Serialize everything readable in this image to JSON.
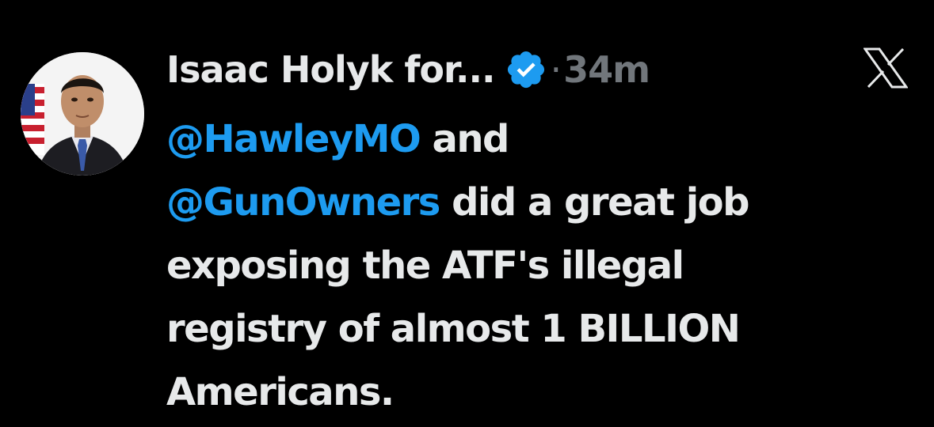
{
  "colors": {
    "background": "#000000",
    "text": "#e7e9ea",
    "mention": "#1d9bf0",
    "secondary": "#71767b",
    "verified": "#1d9bf0"
  },
  "author": {
    "display_name": "Isaac Holyk for...",
    "verified_icon": "verified-badge-icon",
    "separator": "·",
    "time": "34m",
    "avatar_icon": "profile-photo"
  },
  "brand_icon": "x-logo-icon",
  "tweet": {
    "line1": {
      "mention": "@HawleyMO",
      "text": " and"
    },
    "line2": {
      "mention": "@GunOwners",
      "text": " did a great job"
    },
    "line3": "exposing the ATF's illegal",
    "line4": "registry of almost 1 BILLION",
    "line5": "Americans."
  }
}
